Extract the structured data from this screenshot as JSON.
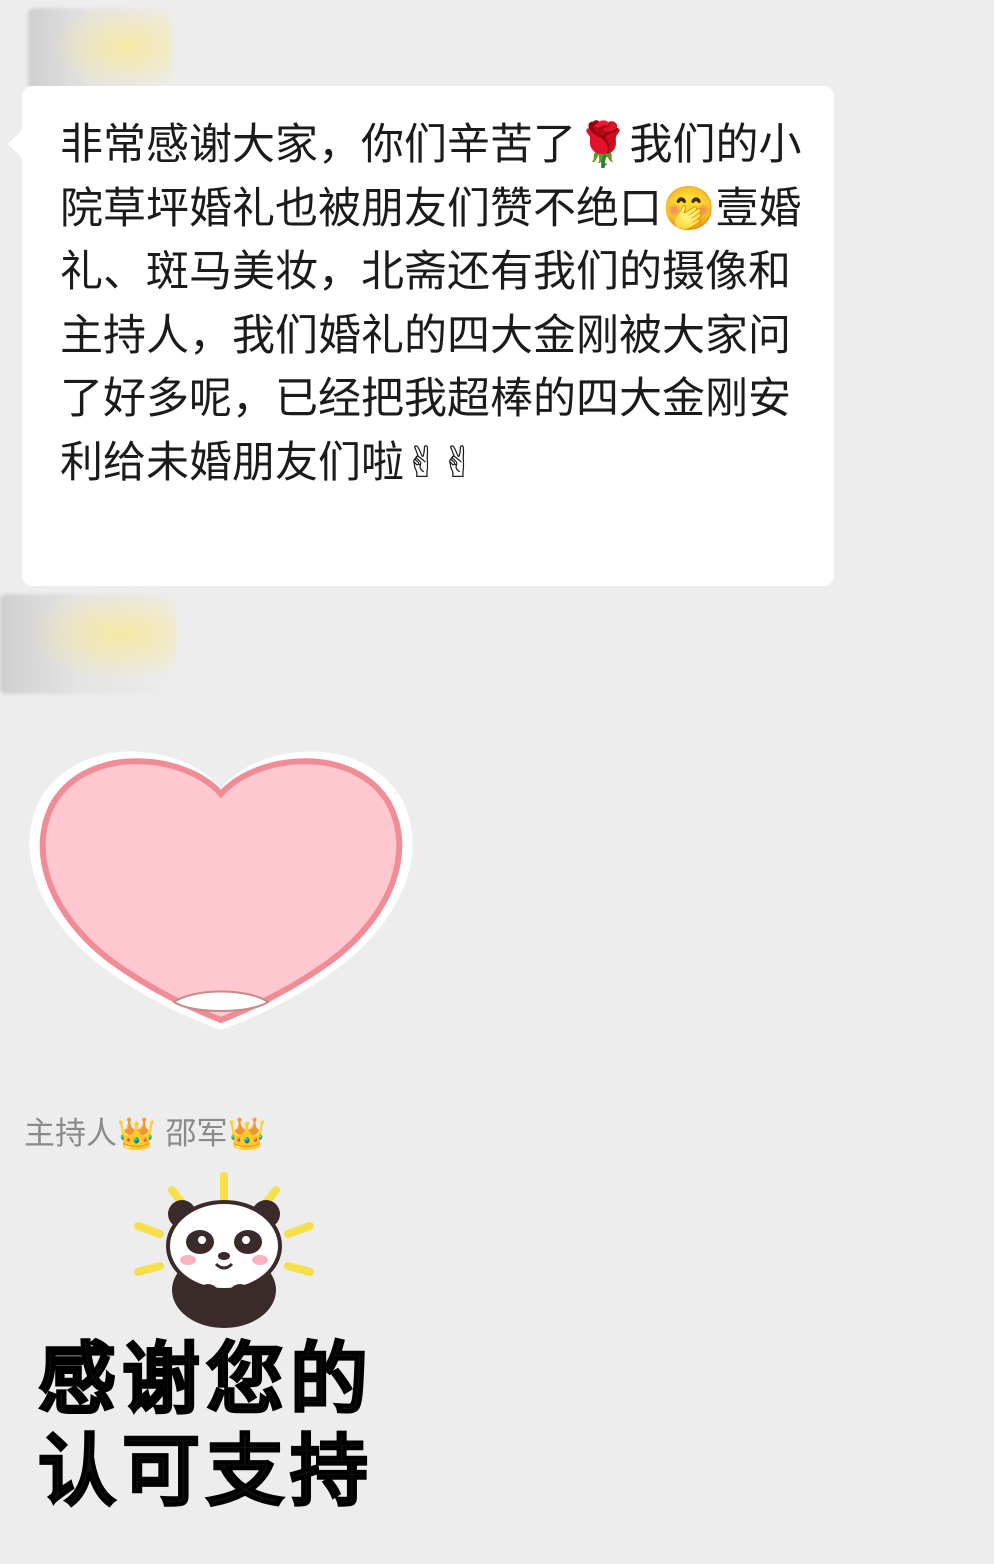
{
  "chat": {
    "message_1": {
      "text": "非常感谢大家，你们辛苦了🌹我们的小院草坪婚礼也被朋友们赞不绝口🤭壹婚礼、斑马美妆，北斋还有我们的摄像和主持人，我们婚礼的四大金刚被大家问了好多呢，已经把我超棒的四大金刚安利给未婚朋友们啦✌✌"
    },
    "message_2": {
      "sticker": "heart-sticker"
    },
    "message_3": {
      "sender_name": "主持人👑 邵军👑",
      "sticker_text": "感谢您的\n认可支持"
    }
  },
  "colors": {
    "background": "#ededed",
    "bubble": "#ffffff",
    "heart_fill": "#ffc8d0",
    "heart_outline": "#f08c95",
    "panda_rays": "#f5e04a"
  }
}
